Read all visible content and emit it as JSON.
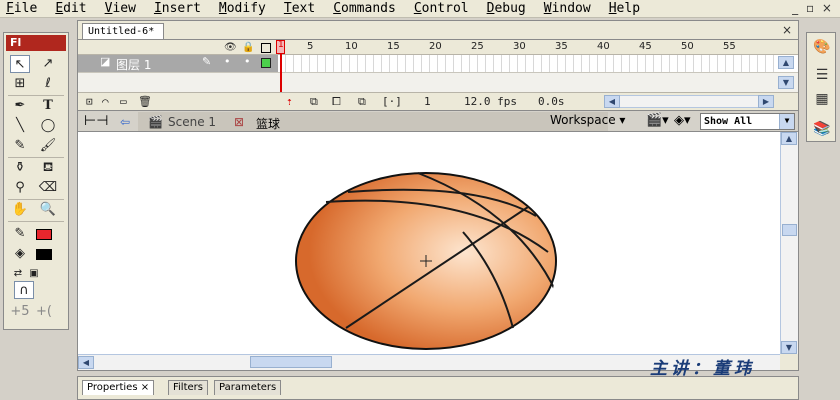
{
  "menu": [
    "File",
    "Edit",
    "View",
    "Insert",
    "Modify",
    "Text",
    "Commands",
    "Control",
    "Debug",
    "Window",
    "Help"
  ],
  "window_controls": "_ ▫ ×",
  "document": {
    "tab_title": "Untitled-6*"
  },
  "tools": {
    "logo": "Fl",
    "fill_color": "#e8262d",
    "stroke_color": "#000000"
  },
  "timeline": {
    "frame_numbers": [
      "5",
      "10",
      "15",
      "20",
      "25",
      "30",
      "35",
      "40",
      "45",
      "50",
      "55"
    ],
    "current_frame_marker": "1",
    "layer_name": "图层 1",
    "current_frame": "1",
    "frame_rate": "12.0 fps",
    "elapsed_time": "0.0s"
  },
  "editbar": {
    "scene_label": "Scene 1",
    "symbol_label": "篮球",
    "workspace_label": "Workspace",
    "zoom_value": "Show All"
  },
  "properties_tabs": [
    "Properties",
    "Filters",
    "Parameters"
  ],
  "watermark": "主讲：董玮",
  "colors": {
    "ball_light": "#fde5cf",
    "ball_mid": "#f1a870",
    "ball_dark": "#d7692c",
    "playhead": "#dd0000",
    "layer_highlight": "#a8a8a8"
  }
}
